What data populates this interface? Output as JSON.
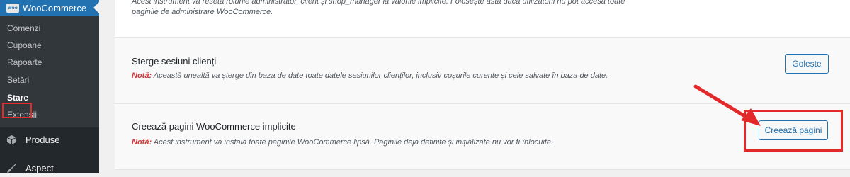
{
  "sidebar": {
    "active_menu": "WooCommerce",
    "woo_icon_text": "woo",
    "submenu": [
      {
        "label": "Comenzi",
        "current": false
      },
      {
        "label": "Cupoane",
        "current": false
      },
      {
        "label": "Rapoarte",
        "current": false
      },
      {
        "label": "Setări",
        "current": false
      },
      {
        "label": "Stare",
        "current": true
      },
      {
        "label": "Extensii",
        "current": false
      }
    ],
    "menu_items": [
      {
        "label": "Produse",
        "icon": "box-icon"
      },
      {
        "label": "Aspect",
        "icon": "brush-icon"
      }
    ]
  },
  "tools": {
    "top_row": {
      "desc_line1": "Acest instrument va reseta rolurile administrator, client și shop_manager la valorile implicite. Folosește asta dacă utilizatorii nu pot accesa toate",
      "desc_line2": "paginile de administrare WooCommerce."
    },
    "sessions": {
      "title": "Șterge sesiuni clienți",
      "note_label": "Notă:",
      "note_text": " Această unealtă va șterge din baza de date toate datele sesiunilor clienților, inclusiv coșurile curente și cele salvate în baza de date.",
      "button": "Golește"
    },
    "pages": {
      "title": "Creează pagini WooCommerce implicite",
      "note_label": "Notă:",
      "note_text": " Acest instrument va instala toate paginile WooCommerce lipsă. Paginile deja definite și inițializate nu vor fi înlocuite.",
      "button": "Creează pagini"
    }
  },
  "colors": {
    "sidebar_bg": "#23282d",
    "submenu_bg": "#32373c",
    "accent": "#2271b1",
    "annotation_red": "#e32a2a",
    "note_red": "#d63638"
  }
}
